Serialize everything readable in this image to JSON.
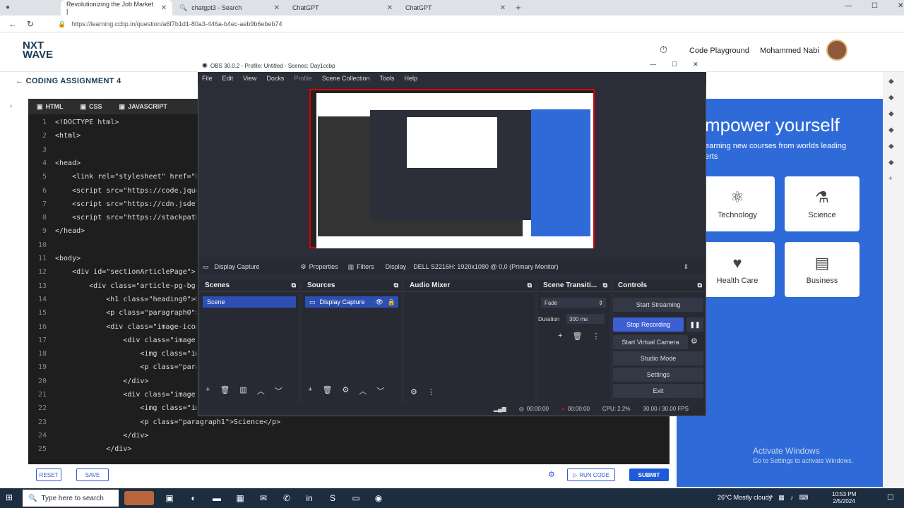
{
  "browser": {
    "tabs": [
      {
        "label": "Revolutionizing the Job Market |",
        "active": true
      },
      {
        "label": "chatgpt3 - Search",
        "active": false
      },
      {
        "label": "ChatGPT",
        "active": false
      },
      {
        "label": "ChatGPT",
        "active": false
      }
    ],
    "url": "https://learning.ccbp.in/question/a6f7b1d1-80a3-446a-b4ec-aeb9b6ebeb74"
  },
  "header": {
    "logo_line1": "NXT",
    "logo_line2": "WAVE",
    "code_playground": "Code Playground",
    "user_name": "Mohammed Nabi"
  },
  "assignment": {
    "title": "CODING ASSIGNMENT 4"
  },
  "editor": {
    "tabs": [
      "HTML",
      "CSS",
      "JAVASCRIPT"
    ],
    "lines": [
      {
        "n": "1",
        "code": "<!DOCTYPE html>"
      },
      {
        "n": "2",
        "code": "<html>"
      },
      {
        "n": "3",
        "code": ""
      },
      {
        "n": "4",
        "code": "<head>"
      },
      {
        "n": "5",
        "code": "    <link rel=\"stylesheet\" href=\"ht"
      },
      {
        "n": "6",
        "code": "    <script src=\"https://code.jquer"
      },
      {
        "n": "7",
        "code": "    <script src=\"https://cdn.jsdeli"
      },
      {
        "n": "8",
        "code": "    <script src=\"https://stackpath."
      },
      {
        "n": "9",
        "code": "</head>"
      },
      {
        "n": "10",
        "code": ""
      },
      {
        "n": "11",
        "code": "<body>"
      },
      {
        "n": "12",
        "code": "    <div id=\"sectionArticlePage\">"
      },
      {
        "n": "13",
        "code": "        <div class=\"article-pg-bg-c"
      },
      {
        "n": "14",
        "code": "            <h1 class=\"heading0\">Em"
      },
      {
        "n": "15",
        "code": "            <p class=\"paragraph0\">E"
      },
      {
        "n": "16",
        "code": "            <div class=\"image-icons"
      },
      {
        "n": "17",
        "code": "                <div class=\"image-i"
      },
      {
        "n": "18",
        "code": "                    <img class=\"ima"
      },
      {
        "n": "19",
        "code": "                    <p class=\"parag"
      },
      {
        "n": "20",
        "code": "                </div>"
      },
      {
        "n": "21",
        "code": "                <div class=\"image-i"
      },
      {
        "n": "22",
        "code": "                    <img class=\"ima"
      },
      {
        "n": "23",
        "code": "                    <p class=\"paragraph1\">Science</p>"
      },
      {
        "n": "24",
        "code": "                </div>"
      },
      {
        "n": "25",
        "code": "            </div>"
      }
    ],
    "reset_label": "RESET",
    "save_label": "SAVE",
    "run_label": "RUN CODE",
    "submit_label": "SUBMIT"
  },
  "output": {
    "title": "mpower yourself",
    "subtitle": "earning new courses from worlds leading erts",
    "cards": [
      {
        "label": "Technology",
        "icon": "chip-icon"
      },
      {
        "label": "Science",
        "icon": "flask-icon"
      },
      {
        "label": "Health Care",
        "icon": "health-icon"
      },
      {
        "label": "Business",
        "icon": "briefcase-icon"
      }
    ],
    "activate_title": "Activate Windows",
    "activate_sub": "Go to Settings to activate Windows."
  },
  "obs": {
    "title": "OBS 30.0.2 - Profile: Untitled - Scenes: Day1ccbp",
    "menu": [
      "File",
      "Edit",
      "View",
      "Docks",
      "Profile",
      "Scene Collection",
      "Tools",
      "Help"
    ],
    "source_bar": {
      "source": "Display Capture",
      "properties": "Properties",
      "filters": "Filters",
      "display_label": "Display",
      "display_value": "DELL S2216H: 1920x1080 @ 0,0 (Primary Monitor)"
    },
    "docks": {
      "scenes": {
        "title": "Scenes",
        "selected": "Scene"
      },
      "sources": {
        "title": "Sources",
        "selected": "Display Capture"
      },
      "mixer": {
        "title": "Audio Mixer"
      },
      "transitions": {
        "title": "Scene Transiti...",
        "type": "Fade",
        "duration_label": "Duration",
        "duration_value": "300 ms"
      },
      "controls": {
        "title": "Controls"
      }
    },
    "controls": [
      "Start Streaming",
      "Stop Recording",
      "Start Virtual Camera",
      "Studio Mode",
      "Settings",
      "Exit"
    ],
    "status": {
      "stream_time": "00:00:00",
      "rec_time": "00:00:00",
      "cpu": "CPU: 2.2%",
      "fps": "30.00 / 30.00 FPS"
    }
  },
  "taskbar": {
    "search_placeholder": "Type here to search",
    "weather": "26°C  Mostly cloudy",
    "time": "10:53 PM",
    "date": "2/5/2024"
  },
  "colors": {
    "accent_blue": "#2e6bd8",
    "obs_bg": "#2b2e38",
    "record_red": "#d00000"
  }
}
